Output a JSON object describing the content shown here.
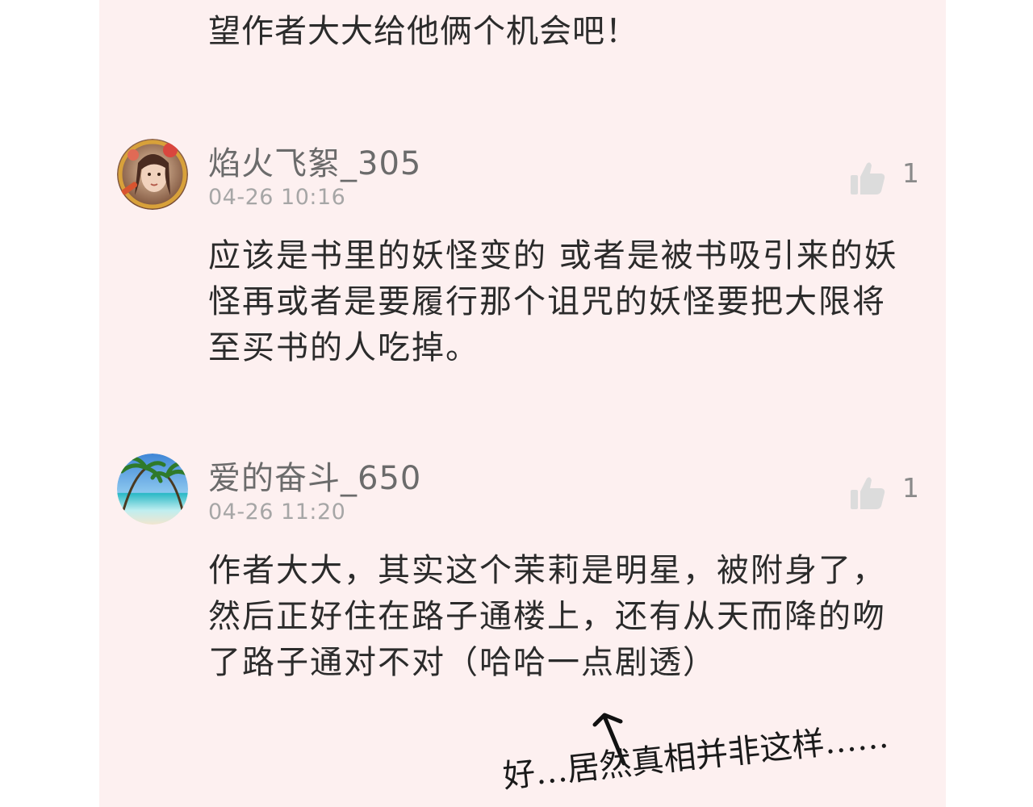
{
  "prev_comment": {
    "text_tail": "望作者大大给他俩个机会吧！"
  },
  "comments": [
    {
      "username": "焰火飞絮_305",
      "timestamp": "04-26 10:16",
      "likes": "1",
      "body": "应该是书里的妖怪变的 或者是被书吸引来的妖怪再或者是要履行那个诅咒的妖怪要把大限将至买书的人吃掉。"
    },
    {
      "username": "爱的奋斗_650",
      "timestamp": "04-26 11:20",
      "likes": "1",
      "body": "作者大大，其实这个茉莉是明星，被附身了，然后正好住在路子通楼上，还有从天而降的吻了路子通对不对（哈哈一点剧透）"
    }
  ],
  "annotation": {
    "text": "好…居然真相并非这样……"
  },
  "colors": {
    "panel_bg": "#fdf0f0",
    "body_text": "#2b2b2b",
    "username": "#6b6b6b",
    "timestamp": "#a6a6a6",
    "like_icon": "#dcdcdc"
  }
}
